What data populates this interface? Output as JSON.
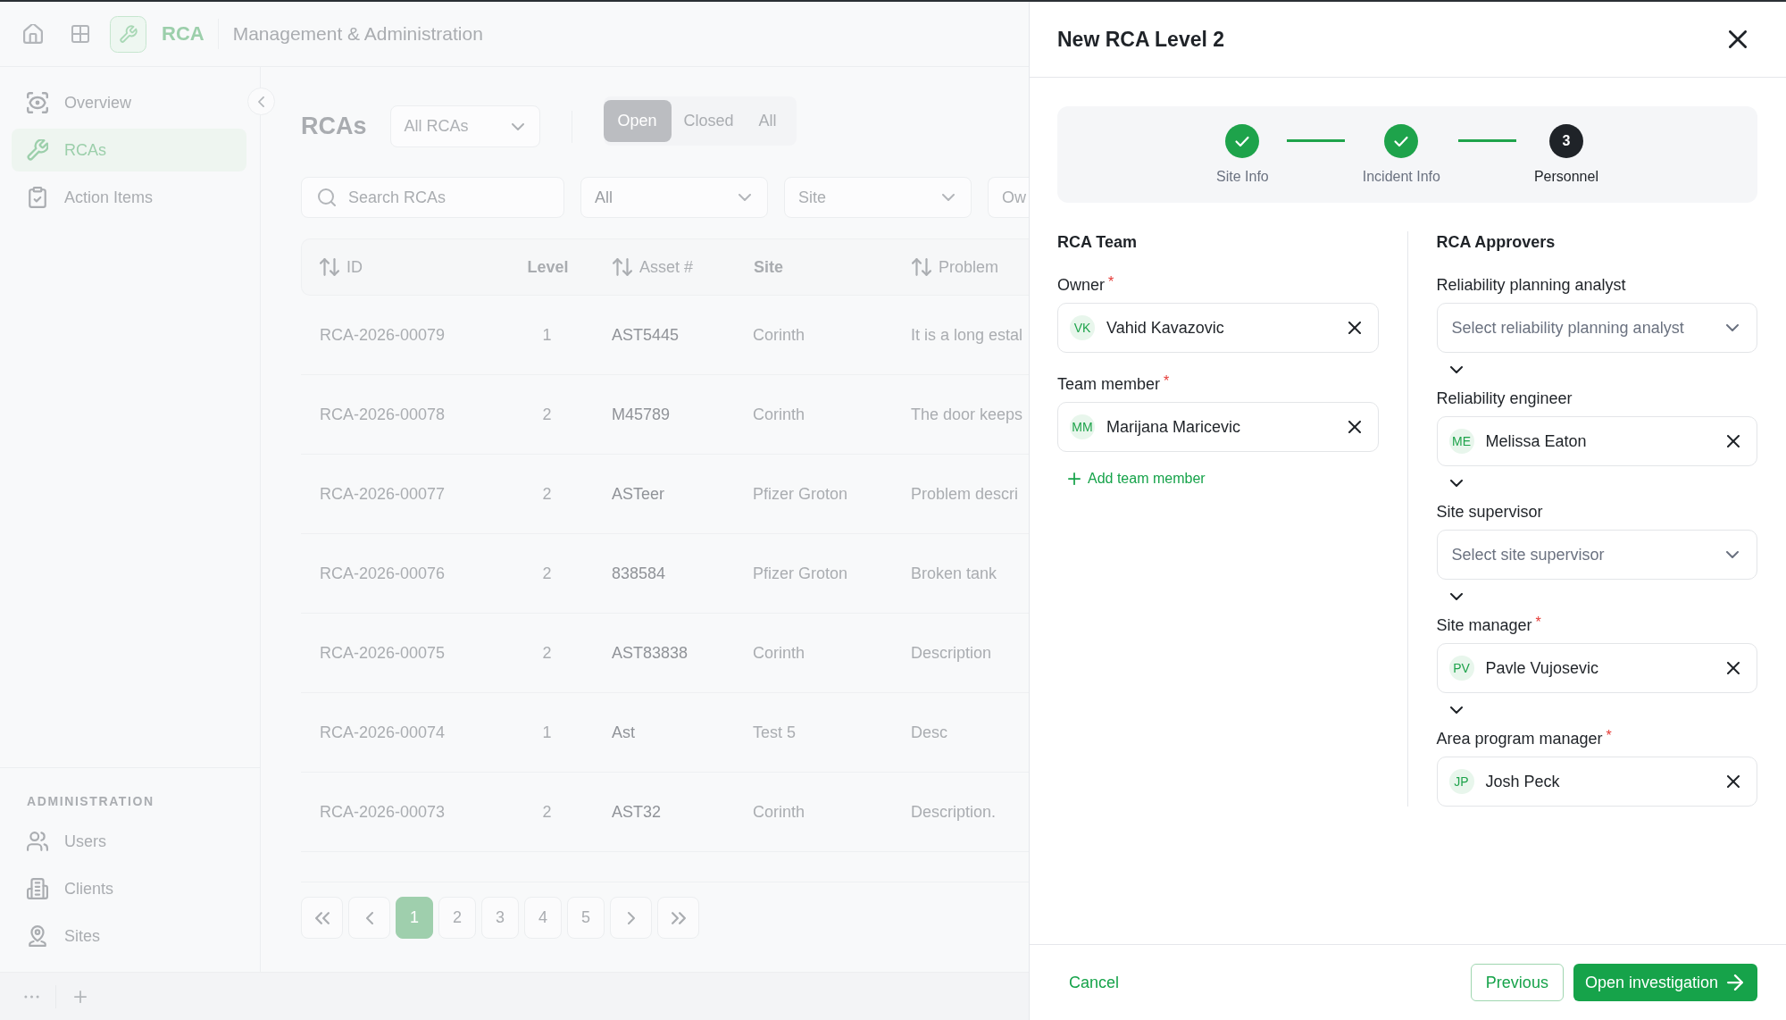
{
  "header": {
    "app_name": "RCA",
    "section": "Management & Administration"
  },
  "sidebar": {
    "items": [
      {
        "label": "Overview",
        "selected": false
      },
      {
        "label": "RCAs",
        "selected": true
      },
      {
        "label": "Action Items",
        "selected": false
      }
    ],
    "admin_heading": "ADMINISTRATION",
    "admin_items": [
      {
        "label": "Users",
        "selected": false
      },
      {
        "label": "Clients",
        "selected": false
      },
      {
        "label": "Sites",
        "selected": false
      }
    ]
  },
  "page": {
    "title": "RCAs",
    "scope": "All RCAs",
    "status_tabs": [
      {
        "label": "Open",
        "selected": true
      },
      {
        "label": "Closed",
        "selected": false
      },
      {
        "label": "All",
        "selected": false
      }
    ]
  },
  "filters": {
    "search": {
      "placeholder": "Search RCAs"
    },
    "level": {
      "value": "All"
    },
    "site": {
      "placeholder": "Site"
    },
    "filter_4": {
      "placeholder": "Ow"
    }
  },
  "table": {
    "columns": [
      {
        "label": "ID",
        "sortable": true
      },
      {
        "label": "Level",
        "sortable": false
      },
      {
        "label": "Asset #",
        "sortable": true
      },
      {
        "label": "Site",
        "sortable": false
      },
      {
        "label": "Problem",
        "sortable": true
      }
    ],
    "rows": [
      [
        "RCA-2026-00079",
        "1",
        "AST5445",
        "Corinth",
        "It is a long estal"
      ],
      [
        "RCA-2026-00078",
        "2",
        "M45789",
        "Corinth",
        "The door keeps"
      ],
      [
        "RCA-2026-00077",
        "2",
        "ASTeer",
        "Pfizer Groton",
        "Problem descri"
      ],
      [
        "RCA-2026-00076",
        "2",
        "838584",
        "Pfizer Groton",
        "Broken tank"
      ],
      [
        "RCA-2026-00075",
        "2",
        "AST83838",
        "Corinth",
        "Description"
      ],
      [
        "RCA-2026-00074",
        "1",
        "Ast",
        "Test 5",
        "Desc"
      ],
      [
        "RCA-2026-00073",
        "2",
        "AST32",
        "Corinth",
        "Description."
      ]
    ]
  },
  "pagination": {
    "pages": [
      {
        "label": "1",
        "selected": true
      },
      {
        "label": "2",
        "selected": false
      },
      {
        "label": "3",
        "selected": false
      },
      {
        "label": "4",
        "selected": false
      },
      {
        "label": "5",
        "selected": false
      }
    ]
  },
  "drawer": {
    "title": "New RCA Level 2",
    "steps": [
      {
        "label": "Site Info",
        "completed": true,
        "current": false
      },
      {
        "label": "Incident Info",
        "completed": true,
        "current": false
      },
      {
        "label": "Personnel",
        "completed": false,
        "current": true,
        "number": "3"
      }
    ],
    "team": {
      "heading": "RCA Team",
      "fields": [
        {
          "label": "Owner",
          "required_mark": "*",
          "kind": "person",
          "initials": "VK",
          "value": "Vahid Kavazovic"
        },
        {
          "label": "Team member",
          "required_mark": "*",
          "kind": "person",
          "initials": "MM",
          "value": "Marijana Maricevic"
        }
      ],
      "add_link": "Add team member"
    },
    "approvers": {
      "heading": "RCA Approvers",
      "fields": [
        {
          "label": "Reliability planning analyst",
          "kind": "select",
          "placeholder": "Select reliability planning analyst",
          "expandable": true
        },
        {
          "label": "Reliability engineer",
          "kind": "person",
          "initials": "ME",
          "value": "Melissa Eaton",
          "expandable": true
        },
        {
          "label": "Site supervisor",
          "kind": "select",
          "placeholder": "Select site supervisor",
          "expandable": true
        },
        {
          "label": "Site manager",
          "required_mark": "*",
          "kind": "person",
          "initials": "PV",
          "value": "Pavle Vujosevic",
          "expandable": true
        },
        {
          "label": "Area program manager",
          "required_mark": "*",
          "kind": "person",
          "initials": "JP",
          "value": "Josh Peck",
          "expandable": false
        }
      ]
    },
    "footer": {
      "cancel": "Cancel",
      "previous": "Previous",
      "submit": "Open investigation"
    }
  }
}
